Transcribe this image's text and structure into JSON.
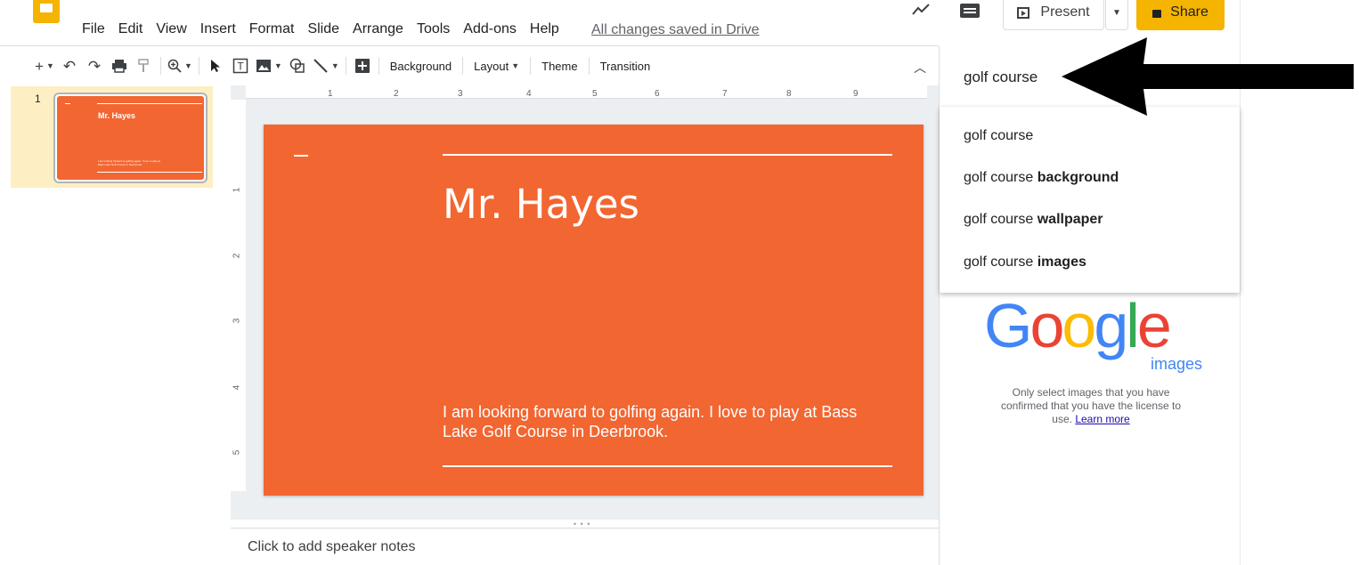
{
  "app": {
    "menus": [
      "File",
      "Edit",
      "View",
      "Insert",
      "Format",
      "Slide",
      "Arrange",
      "Tools",
      "Add-ons",
      "Help"
    ],
    "save_status": "All changes saved in Drive",
    "present_label": "Present",
    "share_label": "Share"
  },
  "toolbar": {
    "icons": [
      "new-slide-icon",
      "undo-icon",
      "redo-icon",
      "print-icon",
      "paint-format-icon",
      "zoom-icon",
      "select-icon",
      "text-box-icon",
      "image-icon",
      "shape-icon",
      "line-icon",
      "comment-add-icon"
    ],
    "background_label": "Background",
    "layout_label": "Layout",
    "theme_label": "Theme",
    "transition_label": "Transition"
  },
  "filmstrip": {
    "slides": [
      {
        "number": "1",
        "title": "Mr. Hayes",
        "body": "I am looking forward to golfing again. I love to play at Bass Lake Golf Course in Deerbrook."
      }
    ]
  },
  "ruler": {
    "horizontal": [
      "1",
      "2",
      "3",
      "4",
      "5",
      "6",
      "7",
      "8",
      "9"
    ],
    "vertical": [
      "1",
      "2",
      "3",
      "4",
      "5"
    ]
  },
  "slide": {
    "title": "Mr. Hayes",
    "body": "I am looking forward to golfing again. I love to play at Bass Lake Golf Course in Deerbrook.",
    "background_color": "#f26631"
  },
  "notes": {
    "placeholder": "Click to add speaker notes"
  },
  "search_panel": {
    "query": "golf course",
    "suggestions": [
      {
        "prefix": "golf course",
        "bold": ""
      },
      {
        "prefix": "golf course ",
        "bold": "background"
      },
      {
        "prefix": "golf course ",
        "bold": "wallpaper"
      },
      {
        "prefix": "golf course ",
        "bold": "images"
      }
    ],
    "logo_letters": [
      "G",
      "o",
      "o",
      "g",
      "l",
      "e"
    ],
    "logo_sub": "images",
    "disclaimer": "Only select images that you have confirmed that you have the license to use.",
    "learn_more": "Learn more"
  },
  "colors": {
    "brand_yellow": "#f4b400",
    "slide_orange": "#f26631",
    "highlight": "#fdefc3"
  }
}
